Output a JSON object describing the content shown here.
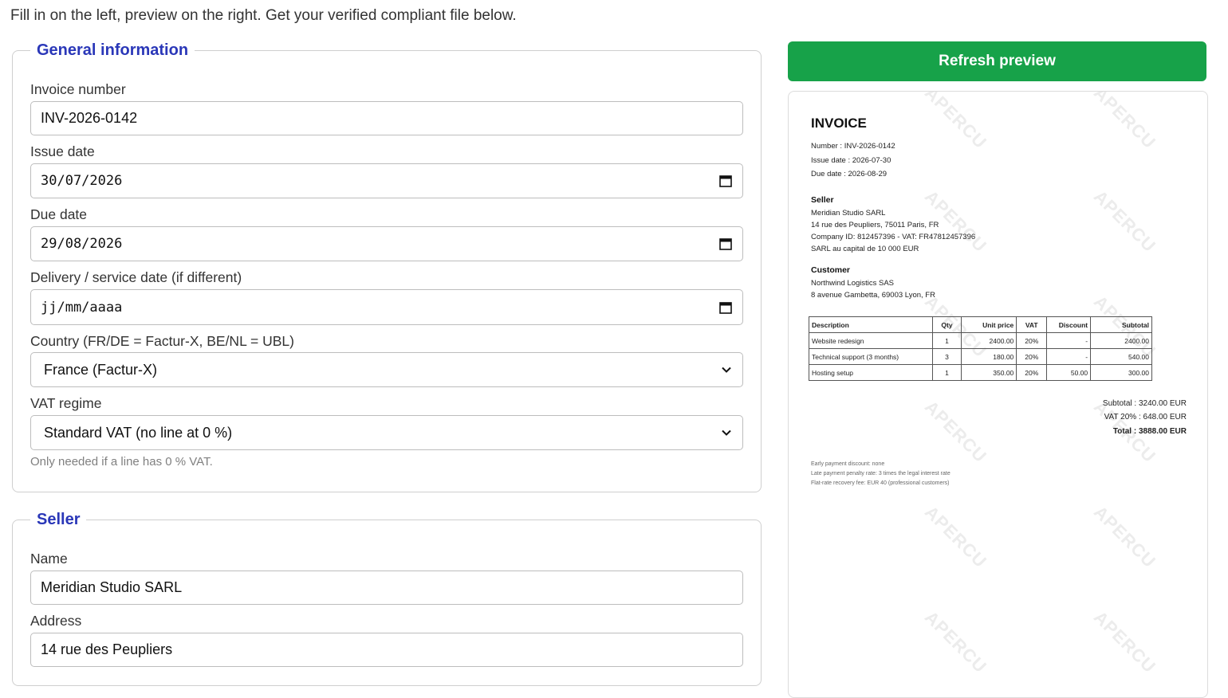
{
  "intro": "Fill in on the left, preview on the right. Get your verified compliant file below.",
  "general": {
    "legend": "General information",
    "invoice_number_label": "Invoice number",
    "invoice_number_value": "INV-2026-0142",
    "issue_date_label": "Issue date",
    "issue_date_value": "30/07/2026",
    "due_date_label": "Due date",
    "due_date_value": "29/08/2026",
    "delivery_date_label": "Delivery / service date (if different)",
    "delivery_date_placeholder": "jj/mm/aaaa",
    "country_label": "Country (FR/DE = Factur-X, BE/NL = UBL)",
    "country_value": "France (Factur-X)",
    "vat_regime_label": "VAT regime",
    "vat_regime_value": "Standard VAT (no line at 0 %)",
    "vat_hint": "Only needed if a line has 0 % VAT."
  },
  "seller": {
    "legend": "Seller",
    "name_label": "Name",
    "name_value": "Meridian Studio SARL",
    "address_label": "Address",
    "address_value": "14 rue des Peupliers"
  },
  "refresh_label": "Refresh preview",
  "preview": {
    "watermark": "APERCU",
    "title": "INVOICE",
    "number": "Number : INV-2026-0142",
    "issue": "Issue date : 2026-07-30",
    "due": "Due date : 2026-08-29",
    "seller_heading": "Seller",
    "seller_lines": [
      "Meridian Studio SARL",
      "14 rue des Peupliers, 75011 Paris, FR",
      "Company ID: 812457396 - VAT: FR47812457396",
      "SARL au capital de 10 000 EUR"
    ],
    "customer_heading": "Customer",
    "customer_lines": [
      "Northwind Logistics SAS",
      "8 avenue Gambetta, 69003 Lyon, FR"
    ],
    "table": {
      "headers": [
        "Description",
        "Qty",
        "Unit price",
        "VAT",
        "Discount",
        "Subtotal"
      ],
      "rows": [
        [
          "Website redesign",
          "1",
          "2400.00",
          "20%",
          "-",
          "2400.00"
        ],
        [
          "Technical support (3 months)",
          "3",
          "180.00",
          "20%",
          "-",
          "540.00"
        ],
        [
          "Hosting setup",
          "1",
          "350.00",
          "20%",
          "50.00",
          "300.00"
        ]
      ]
    },
    "subtotal": "Subtotal : 3240.00 EUR",
    "vat": "VAT 20% : 648.00 EUR",
    "total": "Total : 3888.00 EUR",
    "footnotes": [
      "Early payment discount: none",
      "Late payment penalty rate: 3 times the legal interest rate",
      "Flat-rate recovery fee: EUR 40 (professional customers)"
    ]
  },
  "colors": {
    "legend": "#2a37b8",
    "primary_button": "#17a249"
  }
}
